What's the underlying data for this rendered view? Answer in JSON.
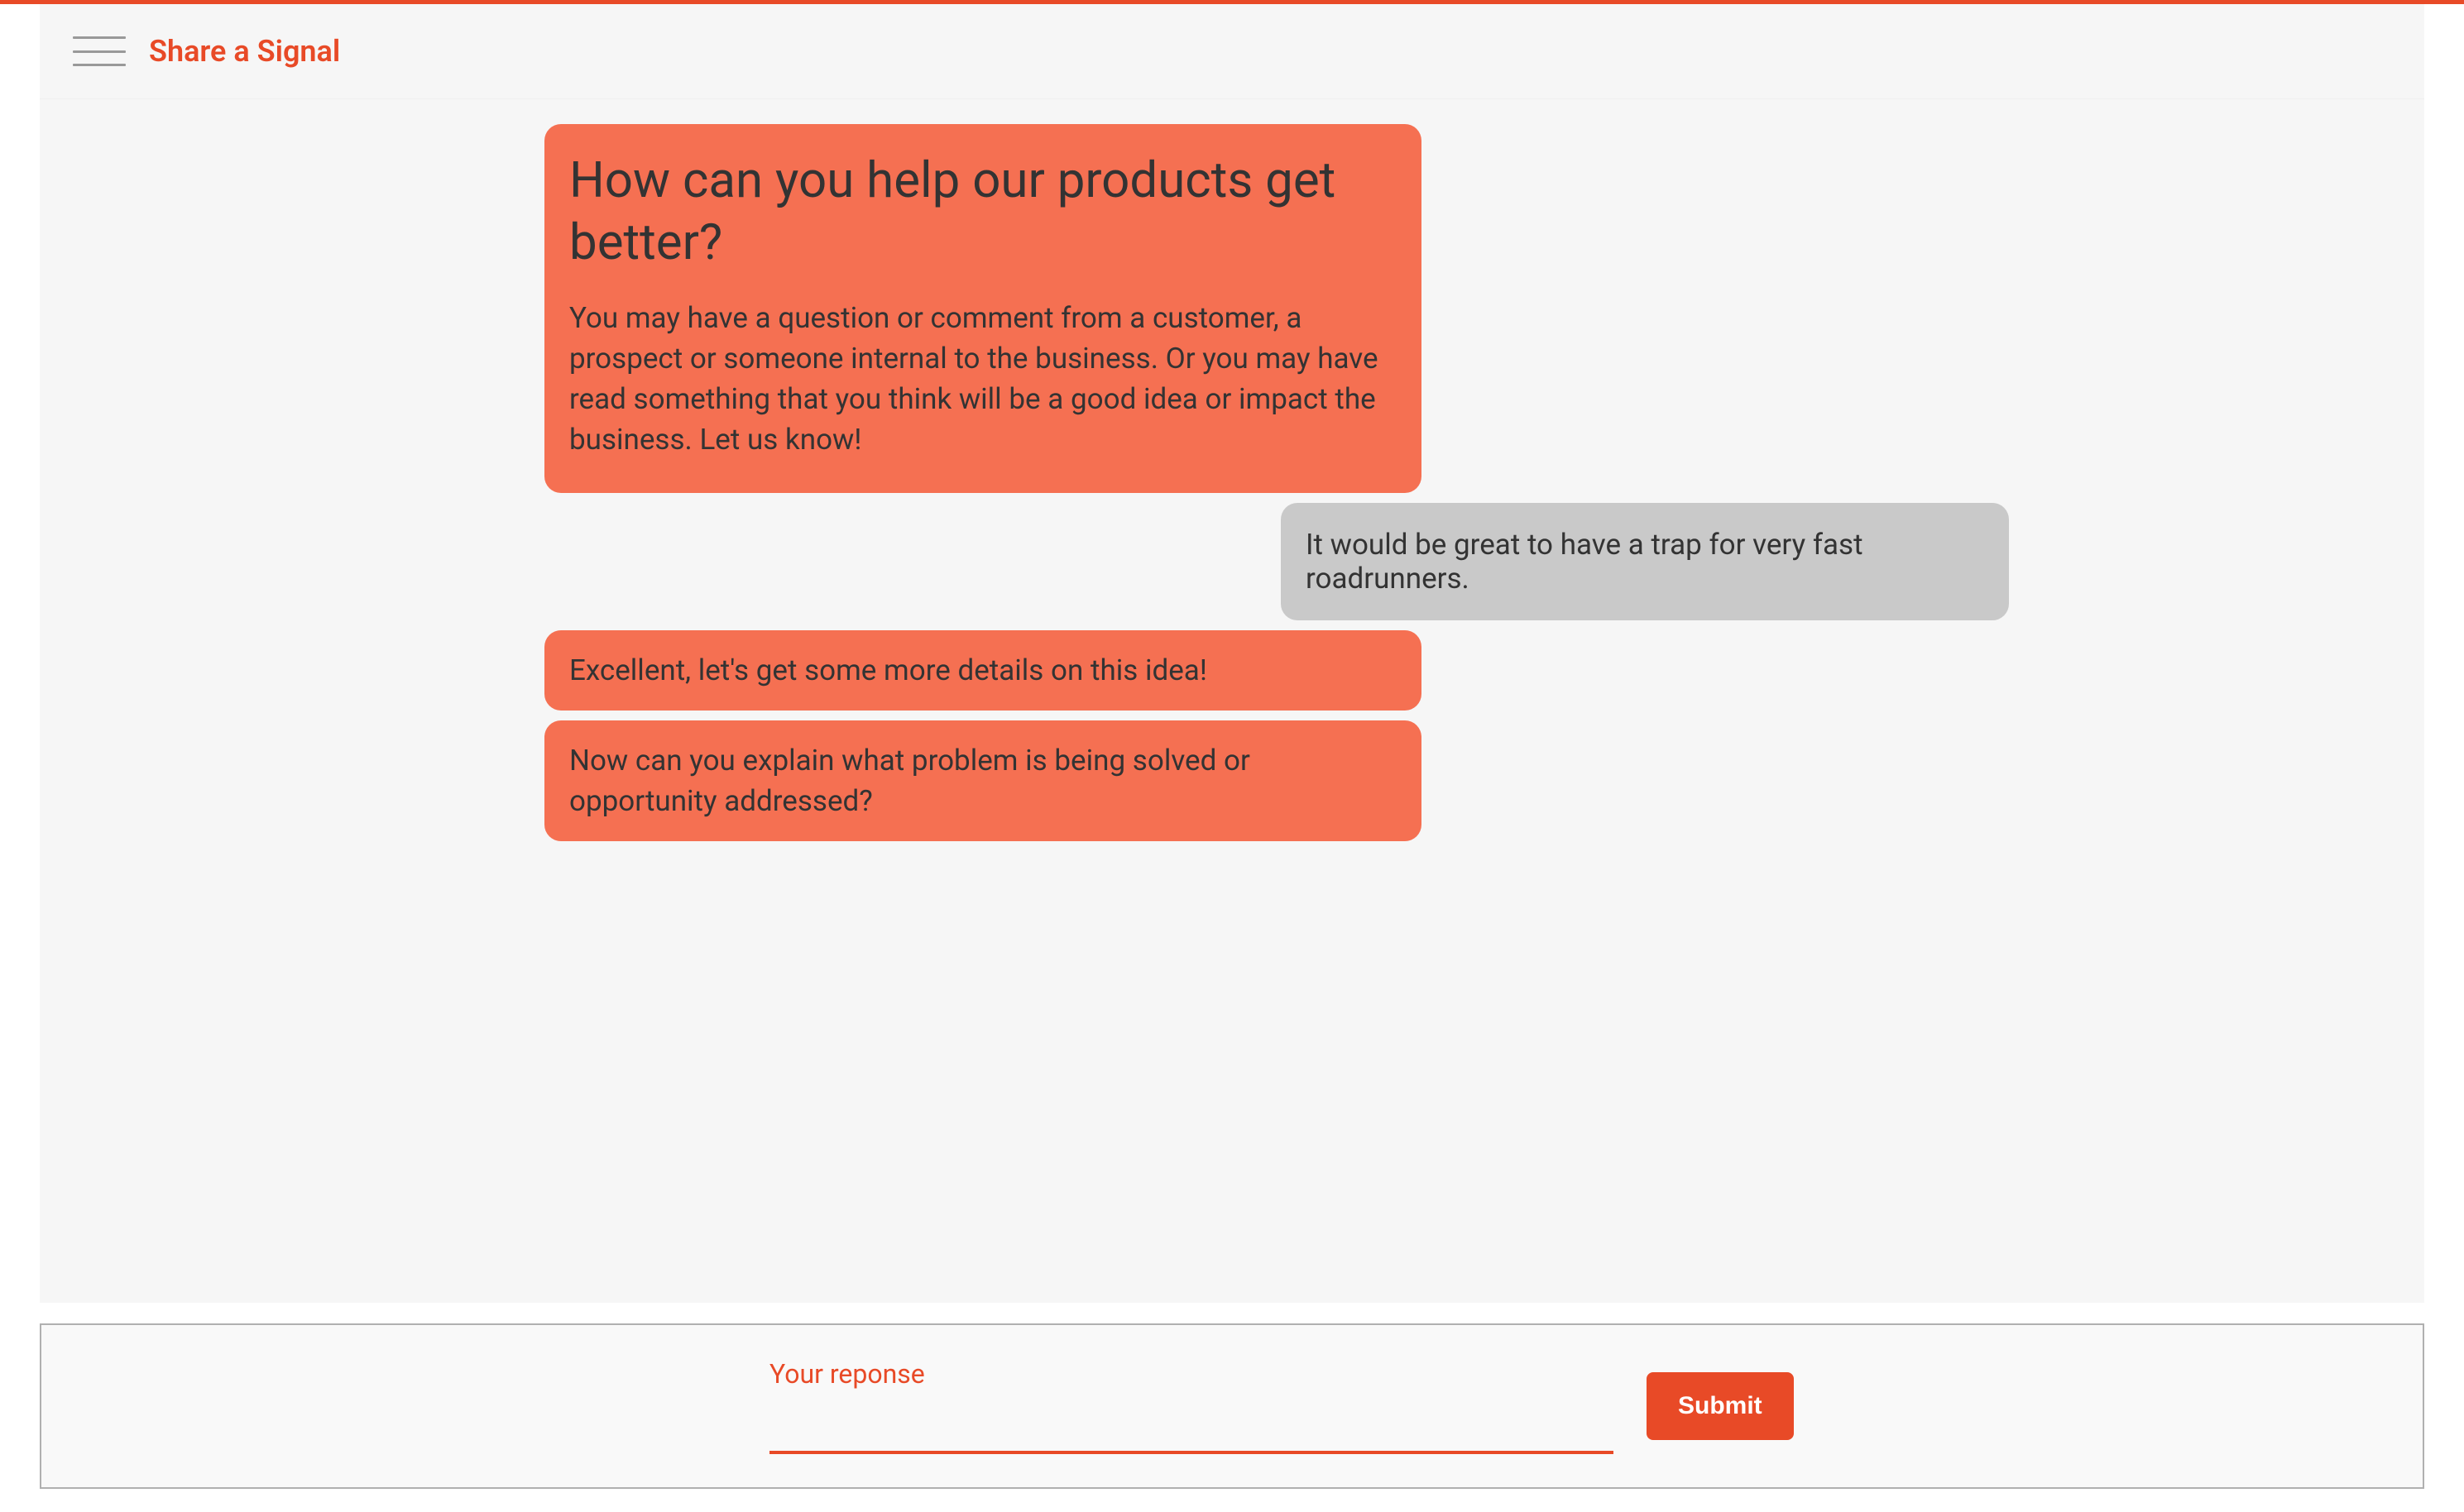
{
  "header": {
    "title": "Share a Signal"
  },
  "chat": {
    "intro_heading": "How can you help our products get better?",
    "intro_body": "You may have a question or comment from a customer, a prospect or someone internal to the business. Or you may have read something that you think will be a good idea or impact the business. Let us know!",
    "user_response_1": "It would be great to have a trap for very fast roadrunners.",
    "bot_reply_1": "Excellent, let's get some more details on this idea!",
    "bot_reply_2": "Now can you explain what problem is being solved or opportunity addressed?"
  },
  "input": {
    "label": "Your reponse",
    "value": "",
    "submit_label": "Submit"
  },
  "colors": {
    "accent": "#e84a27",
    "bot_bubble": "#f57052",
    "user_bubble": "#c9c9c9"
  }
}
